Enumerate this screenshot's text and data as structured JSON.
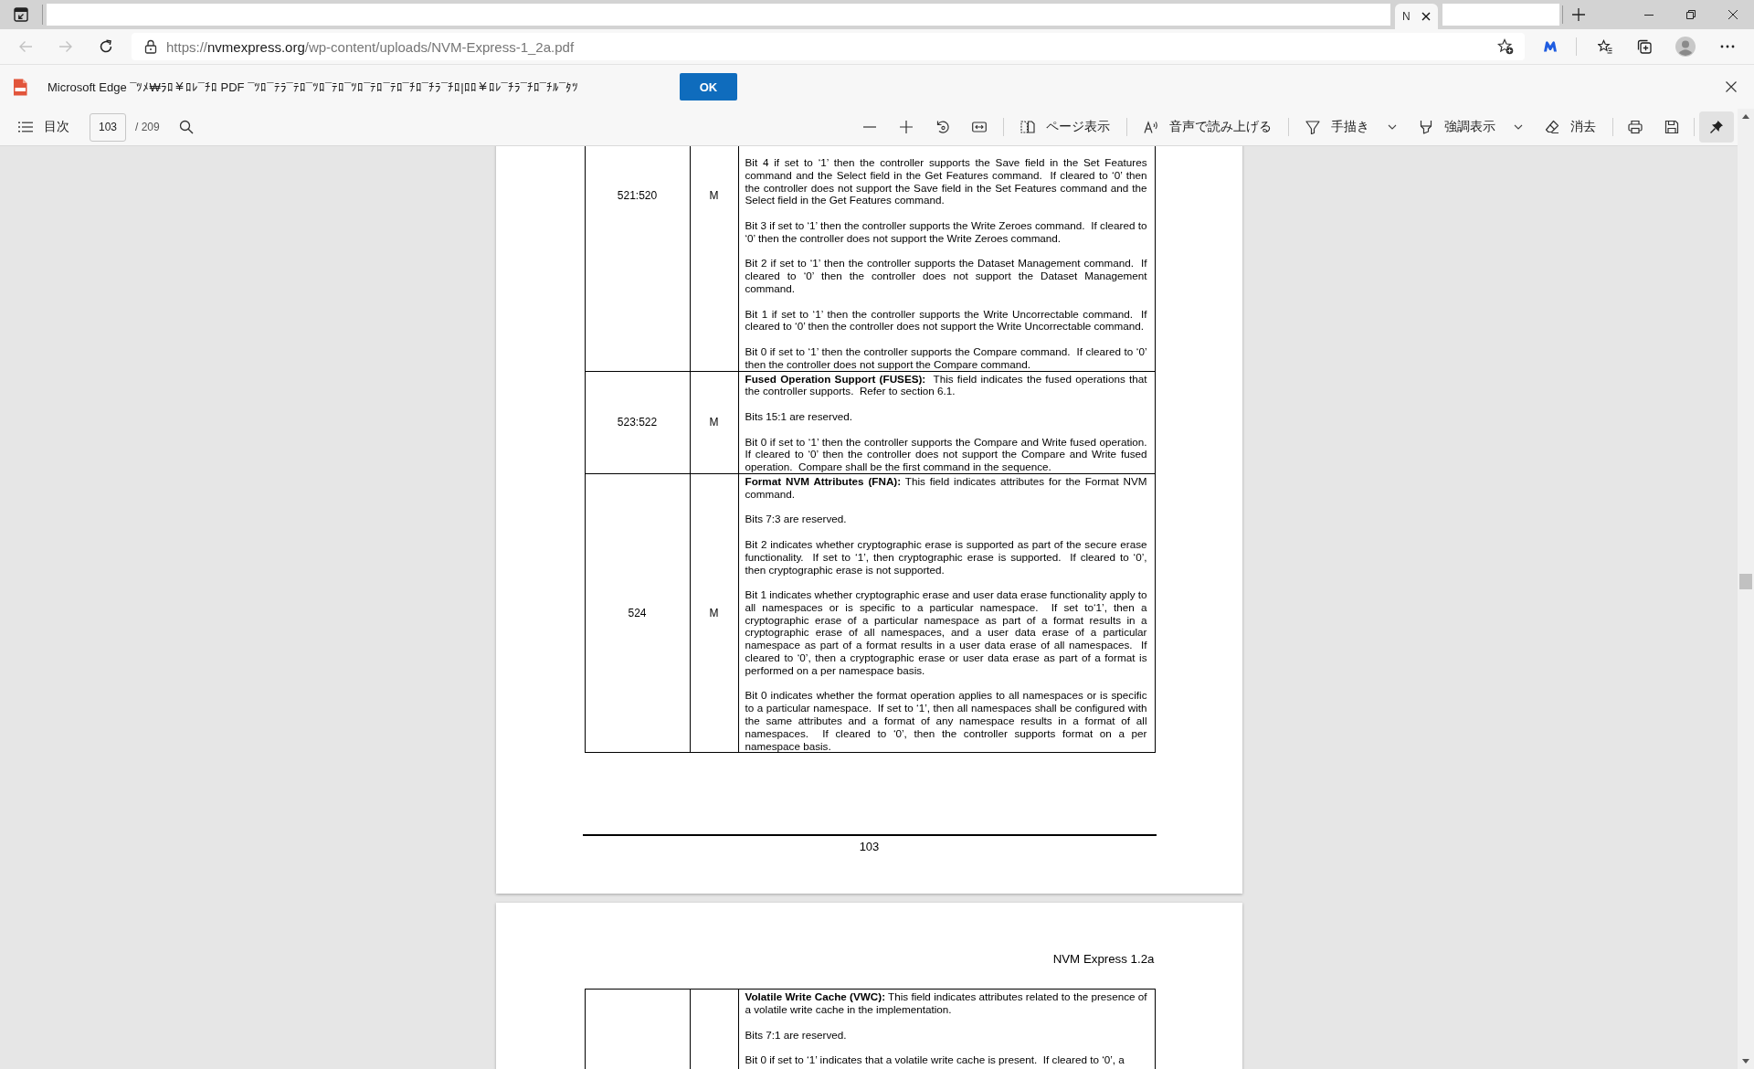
{
  "title_bar": {
    "tabs": [
      {
        "label": "N",
        "selected": true
      }
    ]
  },
  "address_bar": {
    "back_disabled": true,
    "forward_disabled": true,
    "url": {
      "scheme": "https://",
      "host": "nvmexpress.org",
      "path": "/wp-content/uploads/NVM-Express-1_2a.pdf"
    }
  },
  "info_bar": {
    "message": "Microsoft Edge ¯ﾂﾒ₩ﾗﾛ￥ﾛﾚ¯ﾁﾛ PDF ¯ﾂﾛ¯ﾃﾗ¯ﾃﾛ¯ﾂﾛ¯ﾃﾛ¯ﾂﾛ¯ﾃﾛ¯ﾃﾛ¯ﾁﾛ¯ﾁﾗ¯ﾁﾛ|ﾛﾛ￥ﾛﾚ¯ﾁﾗ¯ﾁﾛ¯ﾁﾙ¯ﾀﾂ",
    "button": "OK"
  },
  "pdf_toolbar": {
    "contents_label": "目次",
    "page_field": "103",
    "page_total": "/ 209",
    "tools": [
      {
        "label": "ページ表示",
        "dropdown": false
      },
      {
        "label": "音声で読み上げる",
        "dropdown": false
      },
      {
        "label": "手描き",
        "dropdown": true
      },
      {
        "label": "強調表示",
        "dropdown": true
      },
      {
        "label": "消去",
        "dropdown": false
      }
    ],
    "pin_on": true
  },
  "document": {
    "pages": [
      {
        "table": {
          "rows": [
            {
              "column_1": "521:520",
              "column_2": "M",
              "column_3": [
                "Bit 4 if set to ‘1’ then the controller supports the Save field in the Set Features command and the Select field in the Get Features command.  If cleared to ‘0’ then the controller does not support the Save field in the Set Features command and the Select field in the Get Features command.",
                "Bit 3 if set to ‘1’ then the controller supports the Write Zeroes command.  If cleared to ‘0’ then the controller does not support the Write Zeroes command.",
                "Bit 2 if set to ‘1’ then the controller supports the Dataset Management command.  If cleared to ‘0’ then the controller does not support the Dataset Management command.",
                "Bit 1 if set to ‘1’ then the controller supports the Write Uncorrectable command.  If cleared to ‘0’ then the controller does not support the Write Uncorrectable command.",
                "Bit 0 if set to ‘1’ then the controller supports the Compare command.  If cleared to ‘0’ then the controller does not support the Compare command."
              ]
            },
            {
              "column_1": "523:522",
              "column_2": "M",
              "column_3": [
                "**Fused Operation Support (FUSES):**  This field indicates the fused operations that the controller supports.  Refer to section 6.1.",
                "Bits 15:1 are reserved.",
                "Bit 0 if set to ‘1’ then the controller supports the Compare and Write fused operation.  If cleared to ‘0’ then the controller does not support the Compare and Write fused operation.  Compare shall be the first command in the sequence."
              ]
            },
            {
              "column_1": "524",
              "column_2": "M",
              "column_3": [
                "**Format NVM Attributes (FNA):** This field indicates attributes for the Format NVM command.",
                "Bits 7:3 are reserved.",
                "Bit 2 indicates whether cryptographic erase is supported as part of the secure erase functionality.  If set to ‘1’, then cryptographic erase is supported.  If cleared to ‘0’, then cryptographic erase is not supported.",
                "Bit 1 indicates whether cryptographic erase and user data erase functionality apply to all namespaces or is specific to a particular namespace.  If set to‘1’, then a cryptographic erase of a particular namespace as part of a format results in a cryptographic erase of all namespaces, and a user data erase of a particular namespace as part of a format results in a user data erase of all namespaces.  If cleared to ‘0’, then a cryptographic erase or user data erase as part of a format is performed on a per namespace basis.",
                "Bit 0 indicates whether the format operation applies to all namespaces or is specific to a particular namespace.  If set to ‘1’, then all namespaces shall be configured with the same attributes and a format of any namespace results in a format of all namespaces.  If cleared to ‘0’, then the controller supports format on a per namespace basis."
              ]
            }
          ]
        },
        "page_number": "103"
      },
      {
        "header": "NVM Express 1.2a",
        "table": {
          "rows": [
            {
              "column_3": [
                "**Volatile Write Cache (VWC):** This field indicates attributes related to the presence of a volatile write cache in the implementation.",
                "Bits 7:1 are reserved.",
                "Bit 0 if set to ‘1’ indicates that a volatile write cache is present.  If cleared to ‘0’, a"
              ]
            }
          ]
        }
      }
    ]
  }
}
